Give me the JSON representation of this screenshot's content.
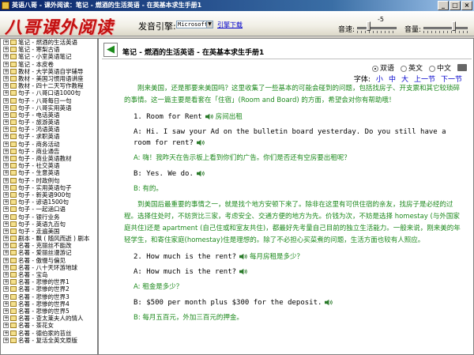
{
  "window": {
    "title": "英语八哥 - 课外阅读：笔记 - 燃酒的生活英语 - 在英基本求生手册1",
    "buttons": [
      "_",
      "□",
      "×"
    ]
  },
  "toolbar": {
    "logo": "八哥课外阅读",
    "engine_label": "发音引擎:",
    "engine_value": "Microsoft Sam",
    "engine_download": "引擎下载",
    "speed_label": "音速:",
    "speed_value": "-5",
    "speed_level": 0.3,
    "volume_label": "音量:",
    "volume_level": 0.7
  },
  "sidebar": {
    "items": [
      "笔记 - 燃酒的生活英语",
      "笔记 - 寒梨古语",
      "笔记 - 小室英语笔记",
      "笔记 - 本皮卷",
      "教材 - 大学英语自学辅导",
      "教材 - 美国习惯用语讲座",
      "教材 - 四十二天写作教程",
      "句子 - 八哥口语1000句",
      "句子 - 八哥每日一句",
      "句子 - 八哥实用英语",
      "句子 - 电话英语",
      "句子 - 旅游英语",
      "句子 - 鸿语英语",
      "句子 - 求职英语",
      "句子 - 商务活动",
      "句子 - 商业通告",
      "句子 - 商业英语教材",
      "句子 - 社交英语",
      "句子 - 生意英语",
      "句子 - 时政例句",
      "句子 - 实用英语句子",
      "句子 - 新英语900句",
      "句子 - 谚语1500句",
      "句子 - 一起涵口语",
      "句子 - 银行业务",
      "句子 - 英语九百句",
      "句子 - 走遍美国",
      "剧本 - 飘 ( 随风而逝 ) 剧本",
      "名著 - 克丽丝不能改",
      "名著 - 爱丽丝漫游记",
      "名著 - 傲慢与偏见",
      "名著 - 八十天环游地球",
      "名著 - 宝岛",
      "名著 - 悲惨的世界1",
      "名著 - 悲惨的世界2",
      "名著 - 悲惨的世界3",
      "名著 - 悲惨的世界4",
      "名著 - 悲惨的世界5",
      "名著 - 查太莱夫人的情人",
      "名著 - 茶花女",
      "名著 - 德伯家的苔丝",
      "名著 - 复活全英文原版"
    ]
  },
  "content": {
    "article_title": "笔记 - 燃酒的生活英语 - 在英基本求生手册1",
    "lang_options": [
      "双语",
      "英文",
      "中文"
    ],
    "lang_selected": 0,
    "font_label": "字体:",
    "font_sizes": [
      "小",
      "中",
      "大"
    ],
    "nav": [
      "上一节",
      "下一节"
    ],
    "paragraphs": [
      {
        "type": "cn",
        "text": "刚来美国，还是那要来美国吗？这里收集了一些基本的可能会碰到的问题，包括找房子、开支票和其它较琐碎的事情。这一篇主要是看套在「住宿」(Room and Board) 的方面，希望会对你有帮助哦！"
      },
      {
        "type": "en",
        "text": "1. Room for Rent",
        "cn": "房间出租"
      },
      {
        "type": "en",
        "text": "A: Hi. I saw your Ad on the bulletin board yesterday. Do you still have a room for rent?",
        "cn": ""
      },
      {
        "type": "cnline",
        "text": "A: 嗨！我昨天在告示板上看到你们的广告。你们是否还有空房要出租呢？"
      },
      {
        "type": "en",
        "text": "B: Yes. We do.",
        "cn": ""
      },
      {
        "type": "cnline",
        "text": "B: 有的。"
      },
      {
        "type": "cn",
        "text": "到美国后最重要的事情之一，就是找个地方安顿下来了。除非在这里有可供住宿的亲友，找房子是必经的过程。选择住处时，不妨货比三家，考虑安全、交通方便的地方为先。价钱为次，不妨是选择 homestay (与外国家庭共住)还是 apartment (自己住或和室友共住)，都最好先考量自己目前的独立生活能力。一般来说，刚来美的年轻学生，和寄住家庭(homestay)住是理想的。除了不必担心买菜煮的问题，生活方面也较有人照应。"
      },
      {
        "type": "en",
        "text": "2. How much is the rent?",
        "cn": "每月房租是多少？"
      },
      {
        "type": "en",
        "text": "A: How much is the rent?",
        "cn": ""
      },
      {
        "type": "cnline",
        "text": "A: 租金是多少？"
      },
      {
        "type": "en",
        "text": "B: $500 per month plus $300 for the deposit.",
        "cn": ""
      },
      {
        "type": "cnline",
        "text": "B: 每月五百元，外加三百元的押金。"
      }
    ]
  },
  "icons": {
    "back": "back-arrow-icon",
    "print": "printer-icon",
    "speaker": "speaker-icon",
    "book": "book-icon"
  },
  "colors": {
    "chinese_text": "#1e8a1e",
    "logo": "#c41010",
    "link": "#0000cc"
  }
}
